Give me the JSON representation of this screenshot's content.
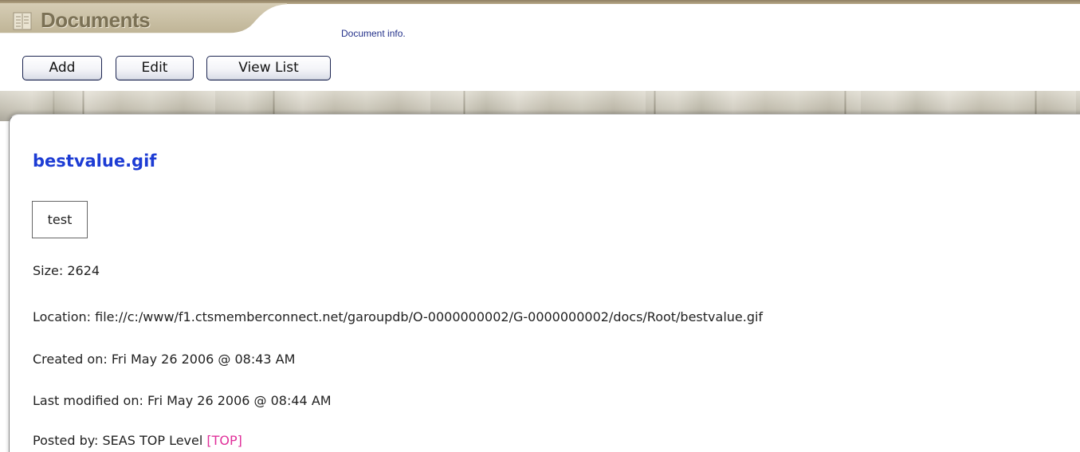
{
  "header": {
    "section_title": "Documents",
    "section_icon": "document-list-icon",
    "info_link": "Document info."
  },
  "toolbar": {
    "add_label": "Add",
    "edit_label": "Edit",
    "view_list_label": "View List"
  },
  "document": {
    "title": "bestvalue.gif",
    "description": "test",
    "size_label": "Size:",
    "size_value": "2624",
    "location_label": "Location:",
    "location_value": "file://c:/www/f1.ctsmemberconnect.net/garoupdb/O-0000000002/G-0000000002/docs/Root/bestvalue.gif",
    "created_label": "Created on:",
    "created_value": "Fri May 26 2006 @ 08:43 AM",
    "modified_label": "Last modified on:",
    "modified_value": "Fri May 26 2006 @ 08:44 AM",
    "posted_label": "Posted by:",
    "posted_value": "SEAS TOP Level",
    "posted_group": "[TOP]"
  },
  "colors": {
    "title_blue": "#1d3cd4",
    "group_link_pink": "#e0309a",
    "header_text": "#7b7155",
    "header_tab": "#c3b99e"
  }
}
